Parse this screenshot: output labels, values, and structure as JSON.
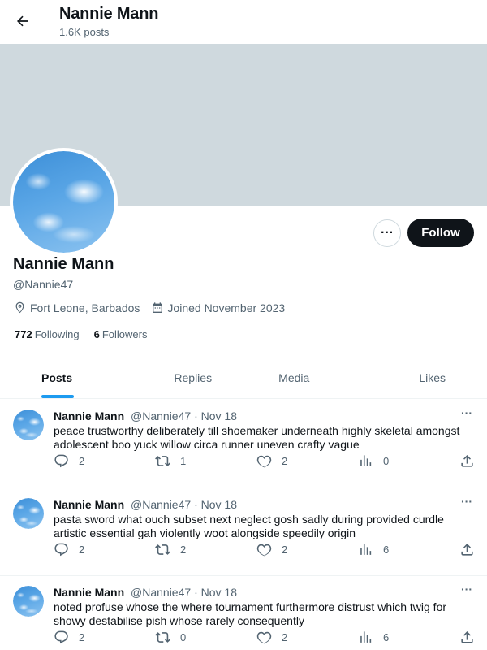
{
  "header": {
    "name": "Nannie Mann",
    "post_count": "1.6K posts"
  },
  "profile": {
    "name": "Nannie Mann",
    "handle": "@Nannie47",
    "location": "Fort Leone, Barbados",
    "joined": "Joined November 2023",
    "following_count": "772",
    "following_label": "Following",
    "followers_count": "6",
    "followers_label": "Followers",
    "follow_label": "Follow",
    "more_label": "···"
  },
  "tabs": [
    {
      "label": "Posts",
      "active": true
    },
    {
      "label": "Replies"
    },
    {
      "label": "Media"
    },
    {
      "label": "Likes"
    }
  ],
  "posts": [
    {
      "name": "Nannie Mann",
      "handle": "@Nannie47",
      "sep": "·",
      "date": "Nov 18",
      "text": "peace trustworthy deliberately till shoemaker underneath highly skeletal amongst adolescent boo yuck willow circa runner uneven crafty vague",
      "replies": "2",
      "reposts": "1",
      "likes": "2",
      "views": "0"
    },
    {
      "name": "Nannie Mann",
      "handle": "@Nannie47",
      "sep": "·",
      "date": "Nov 18",
      "text": "pasta sword what ouch subset next neglect gosh sadly during provided curdle artistic essential gah violently woot alongside speedily origin",
      "replies": "2",
      "reposts": "2",
      "likes": "2",
      "views": "6"
    },
    {
      "name": "Nannie Mann",
      "handle": "@Nannie47",
      "sep": "·",
      "date": "Nov 18",
      "text": "noted profuse whose the where tournament furthermore distrust which twig for showy destabilise pish whose rarely consequently",
      "replies": "2",
      "reposts": "0",
      "likes": "2",
      "views": "6"
    }
  ],
  "colors": {
    "accent": "#1d9bf0",
    "banner": "#cfd9de",
    "follow_bg": "#0f1419",
    "muted": "#536471"
  }
}
